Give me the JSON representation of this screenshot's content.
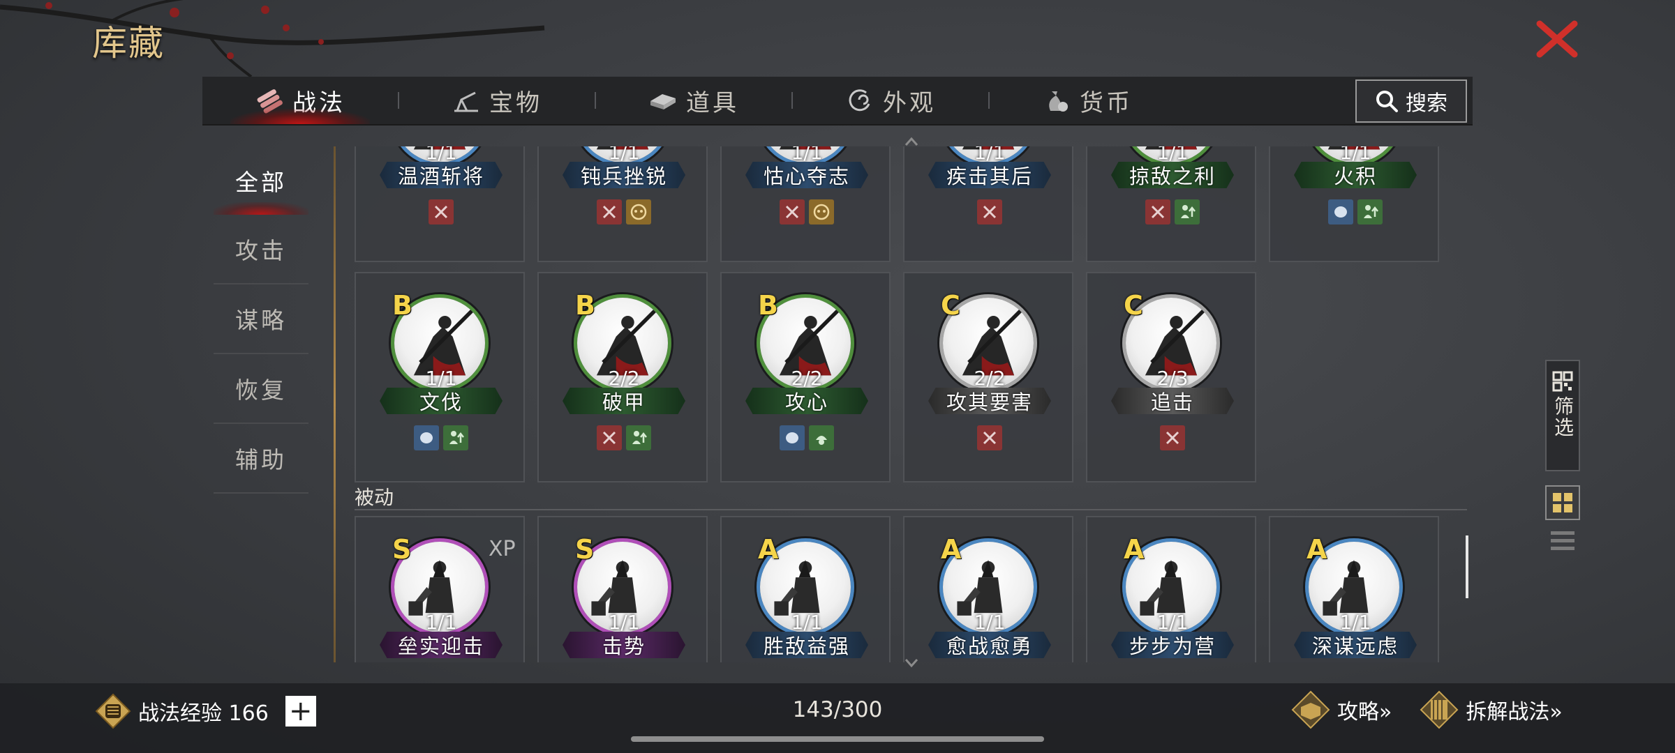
{
  "page": {
    "title": "库藏"
  },
  "tabs": [
    {
      "label": "战法",
      "icon": "scrolls-icon",
      "active": true
    },
    {
      "label": "宝物",
      "icon": "cannon-icon",
      "active": false
    },
    {
      "label": "道具",
      "icon": "bars-icon",
      "active": false
    },
    {
      "label": "外观",
      "icon": "swirl-icon",
      "active": false
    },
    {
      "label": "货币",
      "icon": "money-bag-icon",
      "active": false
    }
  ],
  "search": {
    "label": "搜索"
  },
  "sidenav": [
    {
      "label": "全部",
      "active": true
    },
    {
      "label": "攻击",
      "active": false
    },
    {
      "label": "谋略",
      "active": false
    },
    {
      "label": "恢复",
      "active": false
    },
    {
      "label": "辅助",
      "active": false
    }
  ],
  "rows": [
    {
      "cards": [
        {
          "name": "温酒斩将",
          "count": "1/1",
          "tier": "blue",
          "tags": [
            "sword"
          ]
        },
        {
          "name": "钝兵挫锐",
          "count": "1/1",
          "tier": "blue",
          "tags": [
            "sword",
            "mask"
          ]
        },
        {
          "name": "怙心夺志",
          "count": "1/1",
          "tier": "blue",
          "tags": [
            "sword",
            "mask"
          ]
        },
        {
          "name": "疾击其后",
          "count": "1/1",
          "tier": "blue",
          "tags": [
            "sword"
          ]
        },
        {
          "name": "掠敌之利",
          "count": "1/1",
          "tier": "green",
          "tags": [
            "sword",
            "buff"
          ]
        },
        {
          "name": "火积",
          "count": "1/1",
          "tier": "green",
          "tags": [
            "brain",
            "buff"
          ]
        }
      ]
    },
    {
      "cards": [
        {
          "grade": "B",
          "name": "文伐",
          "count": "1/1",
          "tier": "green",
          "tags": [
            "brain",
            "buff"
          ]
        },
        {
          "grade": "B",
          "name": "破甲",
          "count": "2/2",
          "tier": "green",
          "tags": [
            "sword",
            "buff"
          ]
        },
        {
          "grade": "B",
          "name": "攻心",
          "count": "2/2",
          "tier": "green",
          "tags": [
            "brain",
            "heal"
          ]
        },
        {
          "grade": "C",
          "name": "攻其要害",
          "count": "2/2",
          "tier": "gray",
          "tags": [
            "sword"
          ]
        },
        {
          "grade": "C",
          "name": "追击",
          "count": "2/3",
          "tier": "gray",
          "tags": [
            "sword"
          ]
        }
      ]
    }
  ],
  "passive_section": {
    "label": "被动",
    "cards": [
      {
        "grade": "S",
        "name": "垒实迎击",
        "count": "1/1",
        "tier": "purple",
        "badge": "XP"
      },
      {
        "grade": "S",
        "name": "击势",
        "count": "1/1",
        "tier": "purple"
      },
      {
        "grade": "A",
        "name": "胜敌益强",
        "count": "1/1",
        "tier": "blue"
      },
      {
        "grade": "A",
        "name": "愈战愈勇",
        "count": "1/1",
        "tier": "blue"
      },
      {
        "grade": "A",
        "name": "步步为营",
        "count": "1/1",
        "tier": "blue"
      },
      {
        "grade": "A",
        "name": "深谋远虑",
        "count": "1/1",
        "tier": "blue"
      }
    ]
  },
  "filter": {
    "label": "筛选"
  },
  "bottom": {
    "exp_label": "战法经验 166",
    "plus": "+",
    "capacity": "143/300",
    "guide_label": "攻略»",
    "disassemble_label": "拆解战法»"
  },
  "colors": {
    "tier_blue": "#4a86c0",
    "tier_green": "#4f8f3c",
    "tier_gray": "#a6a6a6",
    "tier_purple": "#b04fb8",
    "tag_red": "#8a3434",
    "tag_gold": "#8b6a2a",
    "tag_blue": "#3d5c82",
    "tag_green": "#3d6e3a",
    "grade_yellow": "#f5d44a"
  }
}
